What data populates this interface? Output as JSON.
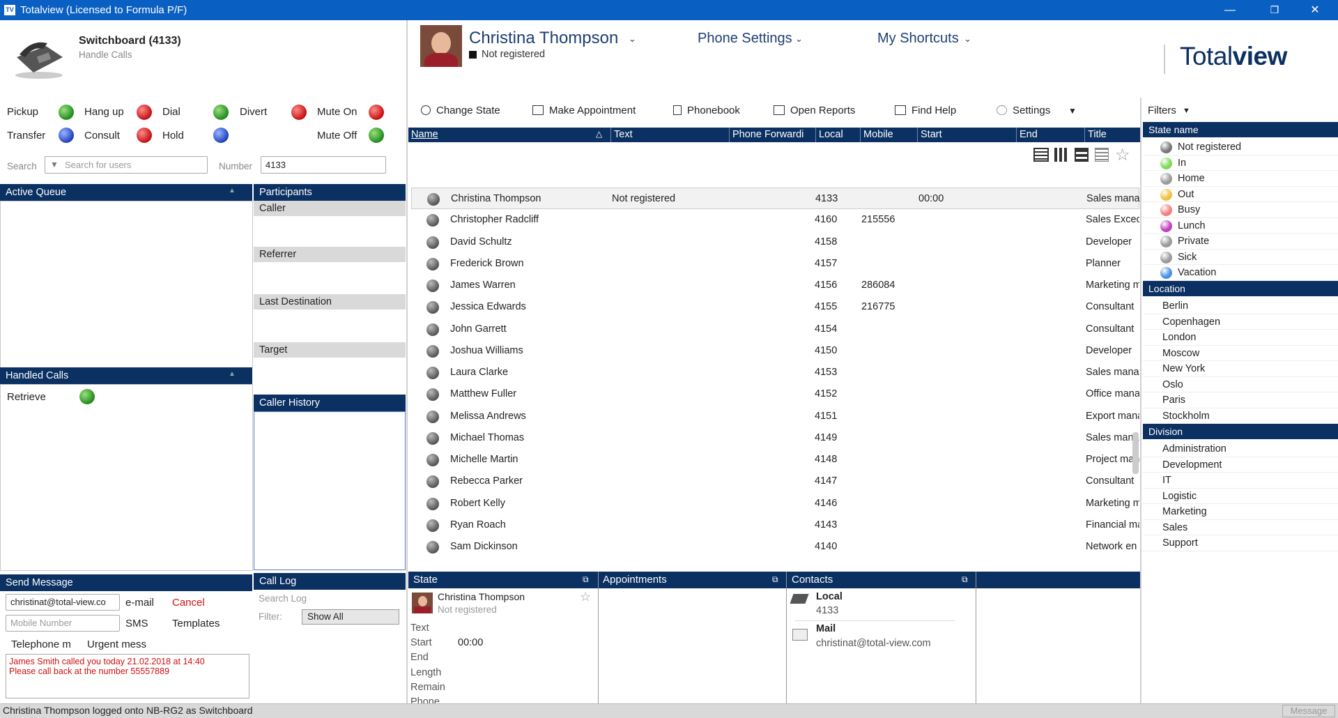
{
  "window": {
    "title": "Totalview  (Licensed to Formula P/F)",
    "logo": "TV",
    "minimize": "—",
    "restore": "❐",
    "close": "✕"
  },
  "switchboard": {
    "title": "Switchboard (4133)",
    "subtitle": "Handle Calls"
  },
  "actions": {
    "pickup": "Pickup",
    "hangup": "Hang up",
    "dial": "Dial",
    "divert": "Divert",
    "mute_on": "Mute On",
    "transfer": "Transfer",
    "consult": "Consult",
    "hold": "Hold",
    "mute_off": "Mute Off"
  },
  "search": {
    "label": "Search",
    "placeholder": "Search for users",
    "number_label": "Number",
    "number_value": "4133"
  },
  "queue": {
    "active_queue": "Active Queue",
    "participants": "Participants",
    "caller": "Caller",
    "referrer": "Referrer",
    "last_destination": "Last Destination",
    "target": "Target",
    "handled_calls": "Handled Calls",
    "retrieve": "Retrieve",
    "caller_history": "Caller History"
  },
  "user": {
    "name": "Christina Thompson",
    "status": "Not registered"
  },
  "menus": {
    "phone_settings": "Phone Settings",
    "my_shortcuts": "My Shortcuts",
    "brand": "Totalview",
    "brand_a": "Total",
    "brand_b": "view"
  },
  "toolbar": {
    "change_state": "Change State",
    "make_appointment": "Make Appointment",
    "phonebook": "Phonebook",
    "open_reports": "Open Reports",
    "find_help": "Find Help",
    "settings": "Settings",
    "filters": "Filters"
  },
  "columns": [
    "Name",
    "Text",
    "Phone Forwardi",
    "Local",
    "Mobile",
    "Start",
    "End",
    "Title"
  ],
  "rows": [
    {
      "name": "Christina Thompson",
      "text": "Not registered",
      "local": "4133",
      "mobile": "",
      "start": "00:00",
      "title": "Sales manag"
    },
    {
      "name": "Christopher Radcliff",
      "text": "",
      "local": "4160",
      "mobile": "215556",
      "start": "",
      "title": "Sales Excecu"
    },
    {
      "name": "David Schultz",
      "text": "",
      "local": "4158",
      "mobile": "",
      "start": "",
      "title": "Developer"
    },
    {
      "name": "Frederick Brown",
      "text": "",
      "local": "4157",
      "mobile": "",
      "start": "",
      "title": "Planner"
    },
    {
      "name": "James Warren",
      "text": "",
      "local": "4156",
      "mobile": "286084",
      "start": "",
      "title": "Marketing m"
    },
    {
      "name": "Jessica Edwards",
      "text": "",
      "local": "4155",
      "mobile": "216775",
      "start": "",
      "title": "Consultant"
    },
    {
      "name": "John Garrett",
      "text": "",
      "local": "4154",
      "mobile": "",
      "start": "",
      "title": "Consultant"
    },
    {
      "name": "Joshua Williams",
      "text": "",
      "local": "4150",
      "mobile": "",
      "start": "",
      "title": "Developer"
    },
    {
      "name": "Laura Clarke",
      "text": "",
      "local": "4153",
      "mobile": "",
      "start": "",
      "title": "Sales manag"
    },
    {
      "name": "Matthew Fuller",
      "text": "",
      "local": "4152",
      "mobile": "",
      "start": "",
      "title": "Office mana"
    },
    {
      "name": "Melissa Andrews",
      "text": "",
      "local": "4151",
      "mobile": "",
      "start": "",
      "title": "Export mana"
    },
    {
      "name": "Michael Thomas",
      "text": "",
      "local": "4149",
      "mobile": "",
      "start": "",
      "title": "Sales manag"
    },
    {
      "name": "Michelle Martin",
      "text": "",
      "local": "4148",
      "mobile": "",
      "start": "",
      "title": "Project man"
    },
    {
      "name": "Rebecca Parker",
      "text": "",
      "local": "4147",
      "mobile": "",
      "start": "",
      "title": "Consultant"
    },
    {
      "name": "Robert Kelly",
      "text": "",
      "local": "4146",
      "mobile": "",
      "start": "",
      "title": "Marketing m"
    },
    {
      "name": "Ryan Roach",
      "text": "",
      "local": "4143",
      "mobile": "",
      "start": "",
      "title": "Financial ma"
    },
    {
      "name": "Sam Dickinson",
      "text": "",
      "local": "4140",
      "mobile": "",
      "start": "",
      "title": "Network en"
    }
  ],
  "filters": {
    "state_header": "State name",
    "states": [
      {
        "label": "Not registered",
        "color": "#777777"
      },
      {
        "label": "In",
        "color": "#7ed957"
      },
      {
        "label": "Home",
        "color": "#9a9a9a"
      },
      {
        "label": "Out",
        "color": "#f0c040"
      },
      {
        "label": "Busy",
        "color": "#f08080"
      },
      {
        "label": "Lunch",
        "color": "#c040c0"
      },
      {
        "label": "Private",
        "color": "#9a9a9a"
      },
      {
        "label": "Sick",
        "color": "#9a9a9a"
      },
      {
        "label": "Vacation",
        "color": "#4a90e2"
      }
    ],
    "location_header": "Location",
    "locations": [
      "Berlin",
      "Copenhagen",
      "London",
      "Moscow",
      "New York",
      "Oslo",
      "Paris",
      "Stockholm"
    ],
    "division_header": "Division",
    "divisions": [
      "Administration",
      "Development",
      "IT",
      "Logistic",
      "Marketing",
      "Sales",
      "Support"
    ]
  },
  "send_message": {
    "title": "Send Message",
    "email_value": "christinat@total-view.co",
    "email_label": "e-mail",
    "cancel": "Cancel",
    "mobile_placeholder": "Mobile Number",
    "sms": "SMS",
    "templates": "Templates",
    "telephone": "Telephone m",
    "urgent": "Urgent mess",
    "message_line1": "James Smith called you today 21.02.2018 at 14:40",
    "message_line2": "Please call back at the number 55557889"
  },
  "call_log": {
    "title": "Call Log",
    "search_placeholder": "Search Log",
    "filter_label": "Filter:",
    "filter_value": "Show All"
  },
  "state_panel": {
    "title": "State",
    "name": "Christina Thompson",
    "status": "Not registered",
    "text": "Text",
    "start": "Start",
    "start_value": "00:00",
    "end": "End",
    "length": "Length",
    "remain": "Remain",
    "phone": "Phone"
  },
  "appointments": {
    "title": "Appointments"
  },
  "contacts": {
    "title": "Contacts",
    "local_label": "Local",
    "local_value": "4133",
    "mail_label": "Mail",
    "mail_value": "christinat@total-view.com"
  },
  "statusbar": {
    "text": "Christina Thompson logged onto NB-RG2 as Switchboard",
    "message": "Message"
  }
}
